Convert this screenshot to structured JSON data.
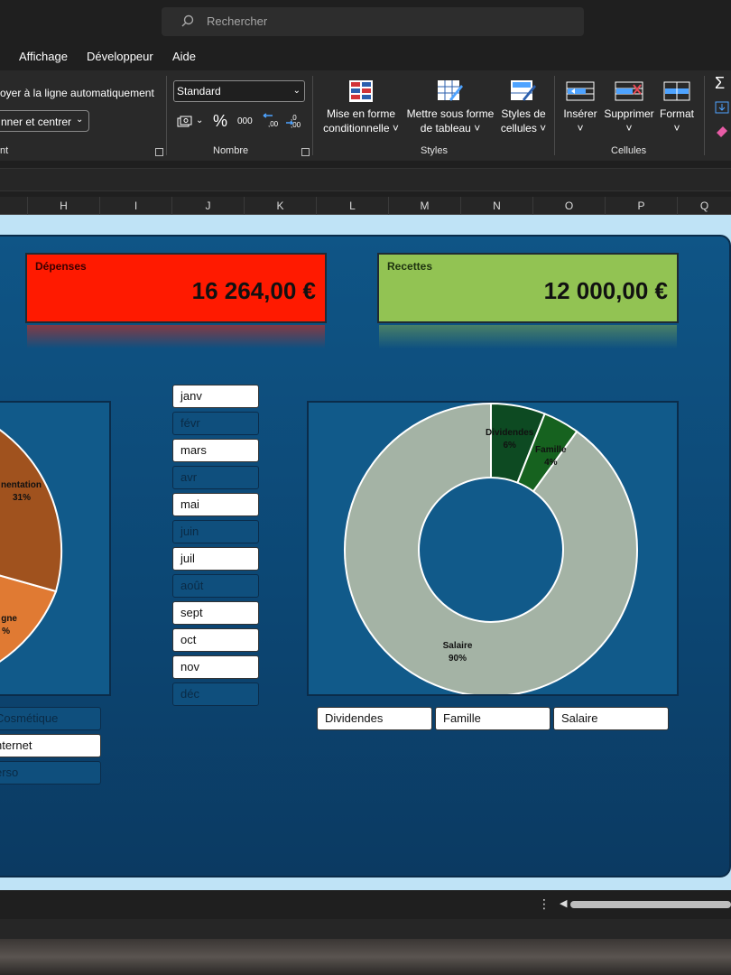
{
  "search": {
    "placeholder": "Rechercher"
  },
  "menu": [
    "Affichage",
    "Développeur",
    "Aide"
  ],
  "ribbon": {
    "wrap_text": "oyer à la ligne automatiquement",
    "merge_center": "nner et centrer",
    "alignment_group": "nt",
    "number_format": "Standard",
    "percent": "%",
    "thousands": "000",
    "number_group": "Nombre",
    "cond_format": [
      "Mise en forme",
      "conditionnelle"
    ],
    "as_table": [
      "Mettre sous forme",
      "de tableau"
    ],
    "cell_styles": [
      "Styles de",
      "cellules"
    ],
    "styles_group": "Styles",
    "insert": "Insérer",
    "delete": "Supprimer",
    "format": "Format",
    "cells_group": "Cellules"
  },
  "columns": [
    "H",
    "I",
    "J",
    "K",
    "L",
    "M",
    "N",
    "O",
    "P",
    "Q"
  ],
  "kpis": {
    "depenses": {
      "label": "Dépenses",
      "value": "16 264,00 €",
      "color": "#ff1a00"
    },
    "recettes": {
      "label": "Recettes",
      "value": "12 000,00 €",
      "color": "#92c353"
    }
  },
  "pie_labels": {
    "a_name": "nentation",
    "a_pct": "31%",
    "b_name": "gne",
    "b_pct": "%"
  },
  "months": [
    {
      "label": "janv",
      "selected": true
    },
    {
      "label": "févr",
      "selected": false
    },
    {
      "label": "mars",
      "selected": true
    },
    {
      "label": "avr",
      "selected": false
    },
    {
      "label": "mai",
      "selected": true
    },
    {
      "label": "juin",
      "selected": false
    },
    {
      "label": "juil",
      "selected": true
    },
    {
      "label": "août",
      "selected": false
    },
    {
      "label": "sept",
      "selected": true
    },
    {
      "label": "oct",
      "selected": true
    },
    {
      "label": "nov",
      "selected": true
    },
    {
      "label": "déc",
      "selected": false
    }
  ],
  "expense_categories": [
    {
      "label": "Cosmétique",
      "selected": false
    },
    {
      "label": "nternet",
      "selected": true
    },
    {
      "label": "erso",
      "selected": false
    }
  ],
  "income_categories": [
    {
      "label": "Dividendes",
      "selected": true
    },
    {
      "label": "Famille",
      "selected": true
    },
    {
      "label": "Salaire",
      "selected": true
    }
  ],
  "chart_data": {
    "type": "pie",
    "donut": true,
    "categories": [
      "Dividendes",
      "Famille",
      "Salaire"
    ],
    "values": [
      6,
      4,
      90
    ],
    "labels": [
      "6%",
      "4%",
      "90%"
    ],
    "colors": [
      "#0d4a22",
      "#16621f",
      "#a4b3a5"
    ]
  }
}
